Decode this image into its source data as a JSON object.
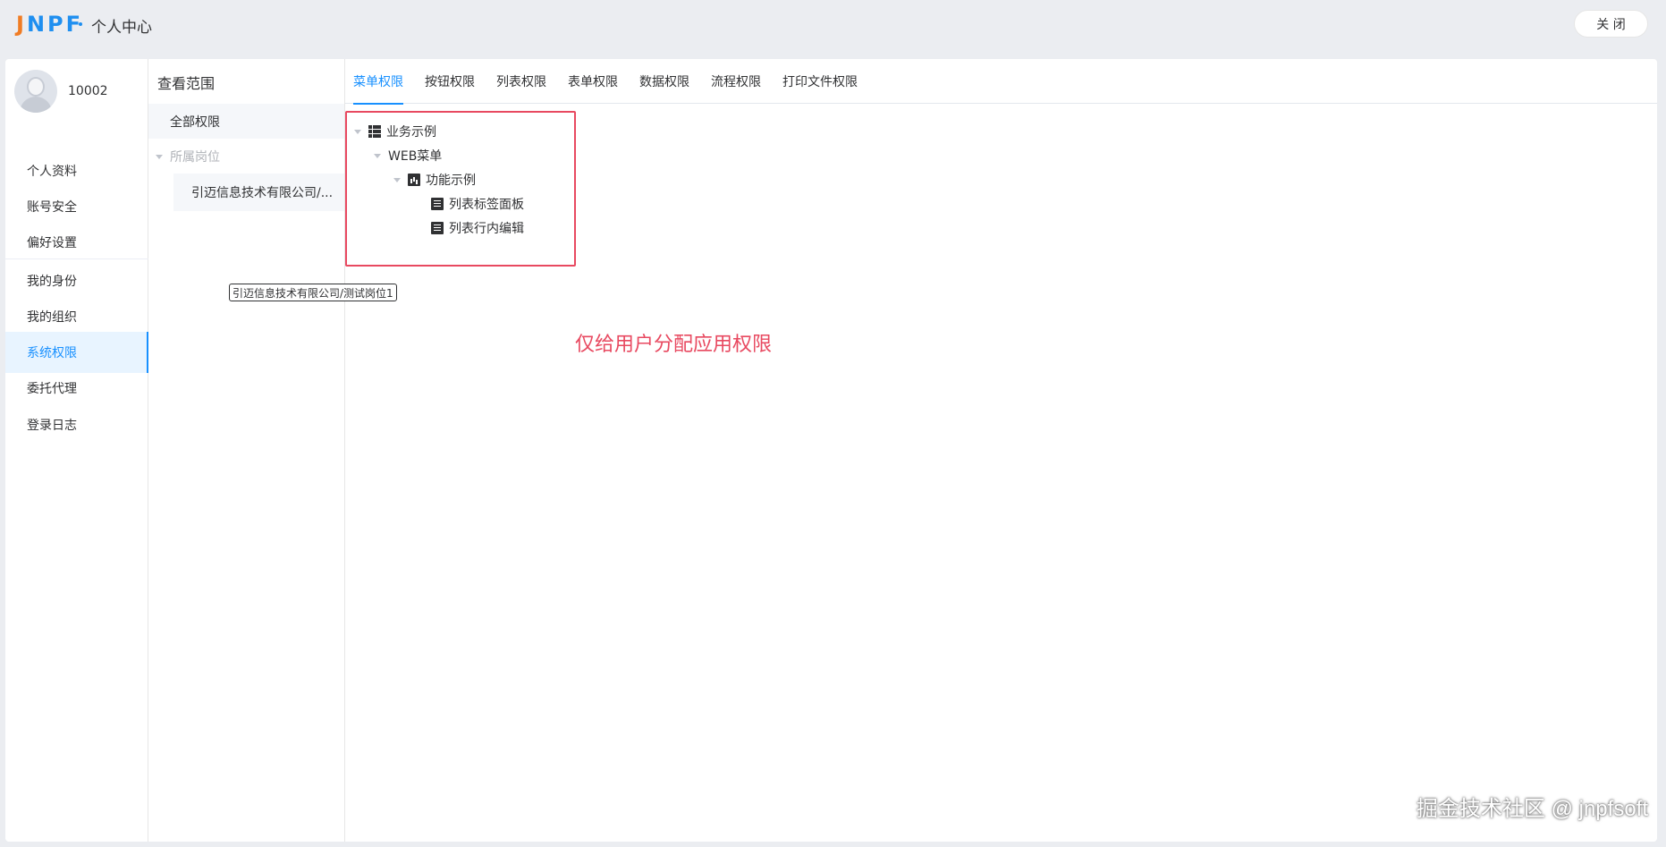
{
  "header": {
    "logo_letters": [
      "J",
      "N",
      "P",
      "F"
    ],
    "title": "个人中心",
    "close_label": "关 闭"
  },
  "user": {
    "id": "10002"
  },
  "nav": {
    "items": [
      "个人资料",
      "账号安全",
      "偏好设置",
      "我的身份",
      "我的组织",
      "系统权限",
      "委托代理",
      "登录日志"
    ],
    "active": "系统权限"
  },
  "scope": {
    "title": "查看范围",
    "all_label": "全部权限",
    "group_label": "所属岗位",
    "sub_label": "引迈信息技术有限公司/...",
    "tooltip": "引迈信息技术有限公司/测试岗位1"
  },
  "tabs": [
    "菜单权限",
    "按钮权限",
    "列表权限",
    "表单权限",
    "数据权限",
    "流程权限",
    "打印文件权限"
  ],
  "tree": [
    {
      "label": "业务示例",
      "icon": "table-icon",
      "level": 0
    },
    {
      "label": "WEB菜单",
      "icon": "",
      "level": 1
    },
    {
      "label": "功能示例",
      "icon": "chart-icon",
      "level": 2
    },
    {
      "label": "列表标签面板",
      "icon": "list-icon",
      "level": 3
    },
    {
      "label": "列表行内编辑",
      "icon": "list-icon",
      "level": 3
    }
  ],
  "annotation": "仅给用户分配应用权限",
  "watermark": "掘金技术社区 @ jnpfsoft",
  "colors": {
    "accent": "#1890ff",
    "annotation": "#e84960",
    "logo_orange": "#f07c24",
    "logo_blue": "#1f8ff0"
  }
}
